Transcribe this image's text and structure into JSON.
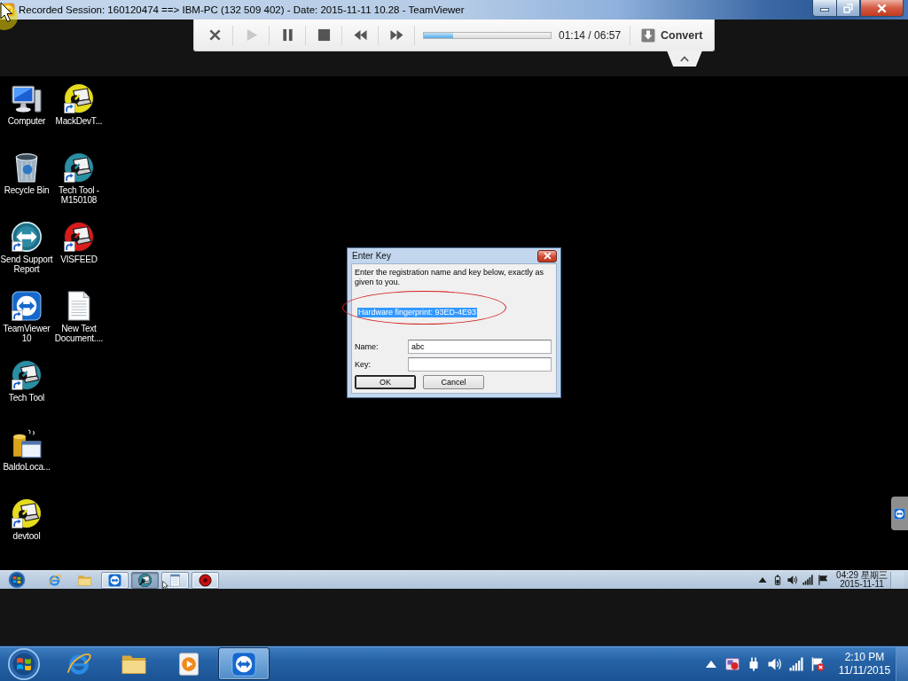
{
  "window": {
    "title": "Recorded Session: 160120474 ==> IBM-PC (132 509 402) - Date: 2015-11-11 10.28 - TeamViewer",
    "controls": [
      {
        "kind": "minimize"
      },
      {
        "kind": "restore"
      },
      {
        "kind": "close"
      }
    ]
  },
  "player": {
    "buttons": [
      {
        "kind": "close",
        "disabled": false
      },
      {
        "kind": "play",
        "disabled": true
      },
      {
        "kind": "pause",
        "disabled": false
      },
      {
        "kind": "stop",
        "disabled": false
      },
      {
        "kind": "rewind",
        "disabled": false
      },
      {
        "kind": "forward",
        "disabled": false
      }
    ],
    "progress": {
      "level": 0.23
    },
    "time": "01:14 / 06:57",
    "convert": "Convert"
  },
  "desktop": {
    "icons": [
      {
        "label": "Computer",
        "kind": "computer",
        "shortcut": false
      },
      {
        "label": "Recycle Bin",
        "kind": "recycle",
        "shortcut": false
      },
      {
        "label": "Send Support Report",
        "kind": "arrows",
        "shortcut": true
      },
      {
        "label": "TeamViewer 10",
        "kind": "remote",
        "shortcut": true
      },
      {
        "label": "Tech Tool",
        "kind": "wrench",
        "color": "#2a8fa3",
        "shortcut": true
      },
      {
        "label": "BaldoLoca...",
        "kind": "package",
        "shortcut": false
      },
      {
        "label": "devtool",
        "kind": "wrench",
        "color": "#e6dc1e",
        "shortcut": true
      },
      {
        "label": "MackDevT...",
        "kind": "wrench",
        "color": "#e6dc1e",
        "shortcut": true
      },
      {
        "label": "Tech Tool - M150108",
        "kind": "wrench",
        "color": "#2a8fa3",
        "shortcut": true
      },
      {
        "label": "VISFEED",
        "kind": "wrench",
        "color": "#d81c1c",
        "shortcut": true
      },
      {
        "label": "New Text Document....",
        "kind": "textfile",
        "shortcut": false
      }
    ]
  },
  "dialog": {
    "title": "Enter Key",
    "message": "Enter the registration name and key below, exactly as given to you.",
    "fingerprint": {
      "text": "Hardware fingerprint: 93ED-4E93",
      "selected": true,
      "circled": true
    },
    "fields": [
      {
        "label": "Name:",
        "value": "abc"
      },
      {
        "label": "Key:"
      }
    ],
    "buttons": [
      {
        "label": "OK",
        "focused": true
      },
      {
        "label": "Cancel",
        "focused": false
      }
    ]
  },
  "remote_taskbar": {
    "items": [
      {
        "kind": "browser",
        "open": false,
        "selected": false
      },
      {
        "kind": "folder",
        "open": false,
        "selected": false
      },
      {
        "kind": "remote",
        "open": true,
        "selected": false
      },
      {
        "kind": "wrench",
        "open": true,
        "selected": true
      },
      {
        "kind": "notepad",
        "open": true,
        "selected": false
      },
      {
        "kind": "record",
        "open": true,
        "selected": false
      }
    ],
    "tray": [
      {
        "kind": "chevron"
      },
      {
        "kind": "battery"
      },
      {
        "kind": "speaker"
      },
      {
        "kind": "signal"
      },
      {
        "kind": "flag"
      }
    ],
    "clock": {
      "time": "04:29 星期三",
      "date": "2015-11-11"
    }
  },
  "taskbar": {
    "items": [
      {
        "kind": "browser",
        "open": false,
        "selected": false
      },
      {
        "kind": "folder",
        "open": false,
        "selected": false
      },
      {
        "kind": "media",
        "open": false,
        "selected": false
      },
      {
        "kind": "remote",
        "open": true,
        "selected": true
      }
    ],
    "tray": [
      {
        "kind": "chevron"
      },
      {
        "kind": "app"
      },
      {
        "kind": "plug"
      },
      {
        "kind": "speaker"
      },
      {
        "kind": "signal"
      },
      {
        "kind": "flagx"
      }
    ],
    "clock": {
      "time": "2:10 PM",
      "date": "11/11/2015"
    }
  }
}
